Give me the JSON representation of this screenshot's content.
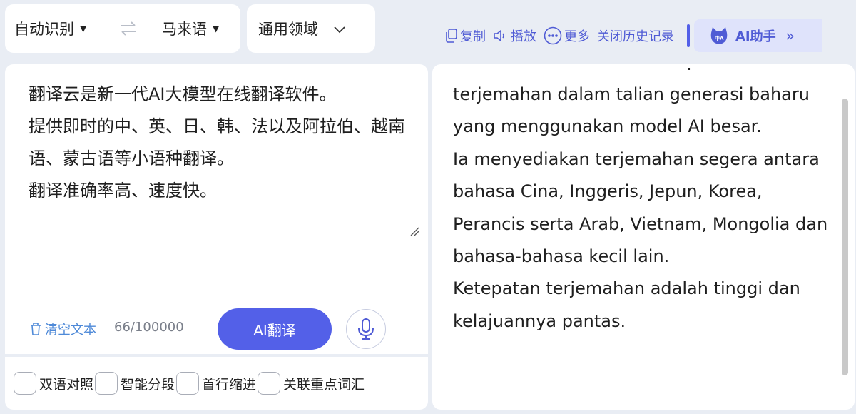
{
  "lang_bar": {
    "source_lang": "自动识别",
    "swap_icon": "⇌",
    "target_lang": "马来语"
  },
  "domain": {
    "selected": "通用领域"
  },
  "toolbar": {
    "copy": "复制",
    "play": "播放",
    "more": "更多",
    "close_history": "关闭历史记录",
    "ai_assistant": "AI助手"
  },
  "input": {
    "text": "翻译云是新一代AI大模型在线翻译软件。\n提供即时的中、英、日、韩、法以及阿拉伯、越南语、蒙古语等小语种翻译。\n翻译准确率高、速度快。",
    "clear_label": "清空文本",
    "char_count": "66/100000",
    "translate_button": "AI翻译"
  },
  "options": [
    {
      "label": "双语对照",
      "checked": false
    },
    {
      "label": "智能分段",
      "checked": false
    },
    {
      "label": "首行缩进",
      "checked": false
    },
    {
      "label": "关联重点词汇",
      "checked": false
    }
  ],
  "output": {
    "text": "terjemahan dalam talian generasi baharu yang menggunakan model AI besar.\nIa menyediakan terjemahan segera antara bahasa Cina, Inggeris, Jepun, Korea, Perancis serta Arab, Vietnam, Mongolia dan bahasa-bahasa kecil lain.\nKetepatan terjemahan adalah tinggi dan kelajuannya pantas."
  },
  "colors": {
    "accent": "#5360e8",
    "page_bg": "#e9edf4",
    "link_blue": "#4f8ad8"
  }
}
